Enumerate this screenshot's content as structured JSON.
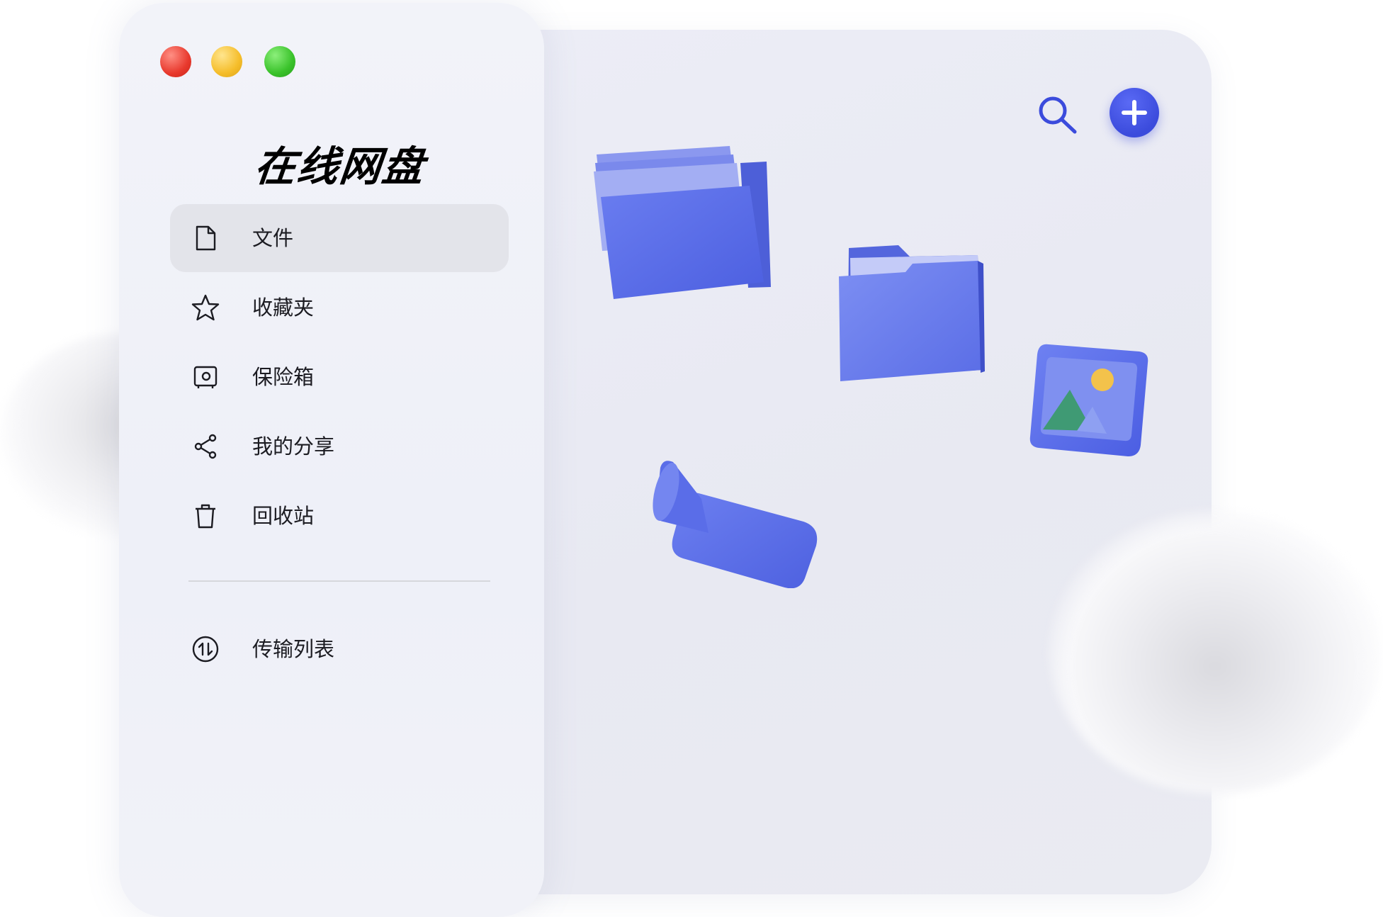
{
  "app": {
    "title": "在线网盘"
  },
  "sidebar": {
    "items": [
      {
        "label": "文件",
        "icon": "file-icon",
        "active": true
      },
      {
        "label": "收藏夹",
        "icon": "star-icon",
        "active": false
      },
      {
        "label": "保险箱",
        "icon": "safe-icon",
        "active": false
      },
      {
        "label": "我的分享",
        "icon": "share-icon",
        "active": false
      },
      {
        "label": "回收站",
        "icon": "trash-icon",
        "active": false
      }
    ],
    "footer_items": [
      {
        "label": "传输列表",
        "icon": "transfer-icon"
      }
    ]
  },
  "toolbar": {
    "search_icon": "search-icon",
    "add_icon": "plus-icon"
  },
  "colors": {
    "accent": "#4a5ce8",
    "folder": "#5b6ee8",
    "traffic_red": "#e8392d",
    "traffic_yellow": "#f5bd2a",
    "traffic_green": "#39c22a"
  }
}
